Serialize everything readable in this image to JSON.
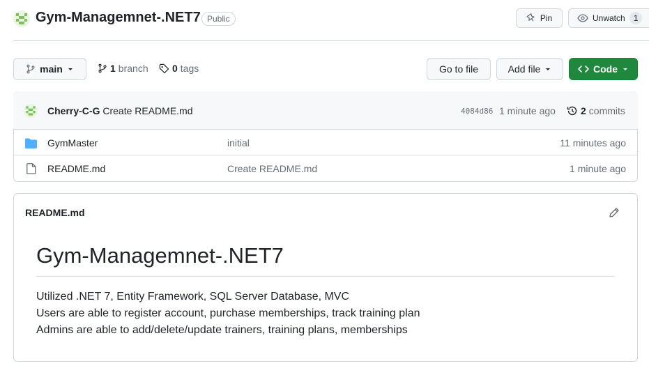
{
  "header": {
    "repo_name": "Gym-Managemnet-.NET7",
    "visibility": "Public",
    "pin_label": "Pin",
    "watch_label": "Unwatch",
    "watch_count": "1"
  },
  "toolbar": {
    "branch_name": "main",
    "branch_count": "1",
    "branch_label": "branch",
    "tag_count": "0",
    "tag_label": "tags",
    "goto_file_label": "Go to file",
    "add_file_label": "Add file",
    "code_label": "Code"
  },
  "latest_commit": {
    "author": "Cherry-C-G",
    "message": "Create README.md",
    "sha": "4084d86",
    "time": "1 minute ago",
    "commit_count": "2",
    "commit_label": "commits"
  },
  "files": [
    {
      "name": "GymMaster",
      "type": "folder",
      "message": "initial",
      "time": "11 minutes ago"
    },
    {
      "name": "README.md",
      "type": "file",
      "message": "Create README.md",
      "time": "1 minute ago"
    }
  ],
  "readme": {
    "filename": "README.md",
    "heading": "Gym-Managemnet-.NET7",
    "lines": [
      "Utilized .NET 7, Entity Framework, SQL Server Database, MVC",
      "Users are able to register account, purchase memberships, track training plan",
      "Admins are able to add/delete/update trainers, training plans, memberships"
    ]
  },
  "colors": {
    "accent_green": "#1f883d",
    "folder_blue": "#54aeff",
    "border": "#d0d7de"
  }
}
